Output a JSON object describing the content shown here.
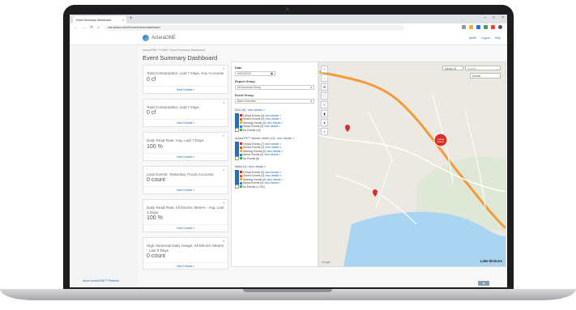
{
  "browser": {
    "tab_title": "Event Summary Dashboard",
    "tab_close": "×",
    "new_tab": "+",
    "url": "usk.aclara.one/#/home/events/dashboard",
    "win_controls": [
      "–",
      "□",
      "×"
    ]
  },
  "header": {
    "app_name": "AclaraONE",
    "user_links": [
      "jsmith",
      "Logout",
      "Help"
    ]
  },
  "breadcrumb": "AclaraONE / HOME / Event Summary Dashboard",
  "page_title": "Event Summary Dashboard",
  "cards": [
    {
      "title": "Total Consumption: Last 7 Days, Key Accounts",
      "value": "0 cf",
      "link": "View Details »"
    },
    {
      "title": "Total Consumption: Last 7 Days",
      "value": "0 cf",
      "link": "View Details »"
    },
    {
      "title": "Daily Read Rate: Avg. Last 7 Days",
      "value": "100 %",
      "link": "View Details »"
    },
    {
      "title": "Leak Events: Yesterday, Focus Accounts",
      "value": "0 count",
      "link": "View Details »"
    },
    {
      "title": "Daily Read Rate: All Electric Meters - Avg. Last 3 Days",
      "value": "100 %",
      "link": "View Details »"
    },
    {
      "title": "High Abnormal Daily Usage: All Electric Meters - Last 5 Days",
      "value": "0 count",
      "link": "View Details »"
    }
  ],
  "filters": {
    "date_label": "Date",
    "date_value": "04/11/2022",
    "report_group_label": "Report Group",
    "report_group_value": "All Accounts Group",
    "event_group_label": "Event Group",
    "event_group_value": "Base Overview",
    "sections": [
      {
        "heading": "DCU (0)",
        "link": "view details »",
        "items": [
          {
            "label": "Critical Events (0)",
            "link": "view details »",
            "color": "#d9302b",
            "checked": true
          },
          {
            "label": "Severe Events (0)",
            "link": "view details »",
            "color": "#e0632a",
            "checked": true
          },
          {
            "label": "Warning Events (0)",
            "link": "view details »",
            "color": "#f2b01e",
            "checked": true
          },
          {
            "label": "Notice Events (0)",
            "link": "view details »",
            "color": "#3b82c4",
            "checked": true
          },
          {
            "label": "No Events (10)",
            "link": "",
            "color": "#4caf50",
            "checked": false
          }
        ]
      },
      {
        "heading": "Aclara RF™ electric meter (13)",
        "link": "view details »",
        "items": [
          {
            "label": "Critical Events (7)",
            "link": "view details »",
            "color": "#d9302b",
            "checked": true
          },
          {
            "label": "Severe Events (0)",
            "link": "view details »",
            "color": "#e0632a",
            "checked": true
          },
          {
            "label": "Warning Events (0)",
            "link": "view details »",
            "color": "#f2b01e",
            "checked": true
          },
          {
            "label": "Notice Events (0)",
            "link": "view details »",
            "color": "#3b82c4",
            "checked": true
          },
          {
            "label": "No Events (6)",
            "link": "",
            "color": "#4caf50",
            "checked": false
          }
        ]
      },
      {
        "heading": "Meter (0)",
        "link": "view details »",
        "items": [
          {
            "label": "Critical Events (0)",
            "link": "view details »",
            "color": "#d9302b",
            "checked": true
          },
          {
            "label": "Severe Events (0)",
            "link": "view details »",
            "color": "#e0632a",
            "checked": true
          },
          {
            "label": "Warning Events (0)",
            "link": "view details »",
            "color": "#f2b01e",
            "checked": true
          },
          {
            "label": "Notice Events (0)",
            "link": "view details »",
            "color": "#3b82c4",
            "checked": true
          },
          {
            "label": "No Events (1,700)",
            "link": "",
            "color": "#4caf50",
            "checked": false
          }
        ]
      }
    ]
  },
  "map": {
    "search_type": "Device ID",
    "search_placeholder": "Search",
    "details_select": "Details",
    "marker_label": "Critical Events",
    "place_label": "Lake Elsinore",
    "attribution": "Google"
  },
  "sidebar": {
    "bottom_link": "About AclaraONE™ Platform"
  },
  "scroll_top_label": "▲"
}
